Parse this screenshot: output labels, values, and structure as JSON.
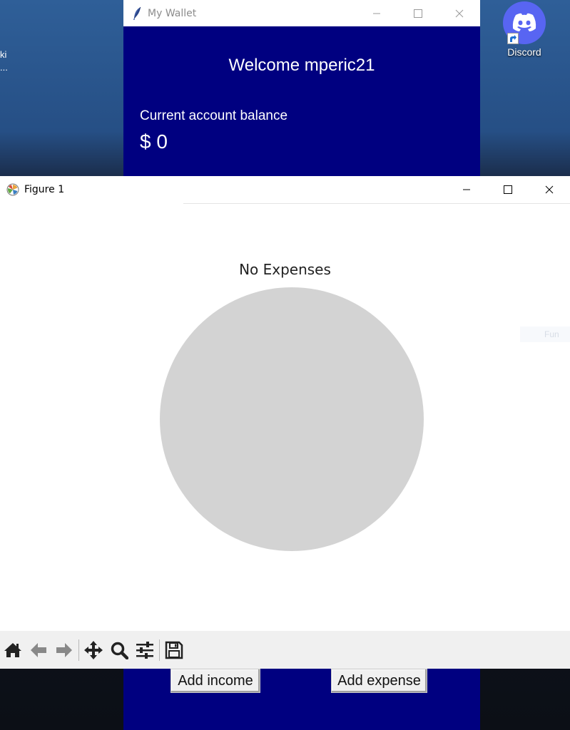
{
  "desktop": {
    "left_fragments": [
      "ki",
      "..."
    ],
    "discord_label": "Discord"
  },
  "wallet": {
    "window_title": "My Wallet",
    "welcome": "Welcome mperic21",
    "balance_label": "Current account balance",
    "balance_value": "$ 0",
    "add_income_label": "Add income",
    "add_expense_label": "Add expense",
    "background_color": "#000080"
  },
  "figure": {
    "window_title": "Figure 1",
    "ghost_text": "Fun",
    "toolbar_icons": [
      "home-icon",
      "back-arrow-icon",
      "forward-arrow-icon",
      "pan-icon",
      "zoom-icon",
      "configure-subplots-icon",
      "save-icon"
    ]
  },
  "chart_data": {
    "type": "pie",
    "title": "No Expenses",
    "labels": [],
    "values": [
      1
    ],
    "colors": [
      "#d3d3d3"
    ]
  }
}
